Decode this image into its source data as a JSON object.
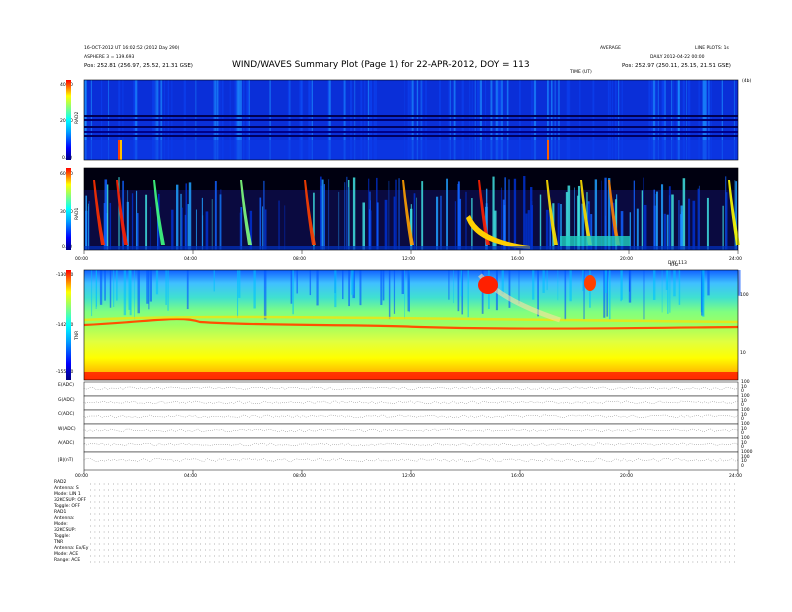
{
  "header": {
    "left_line1": "16-OCT-2012 UT 16:02:52 (2012 Day 290)",
    "left_line2": "ASPHERE 3 = 139.693",
    "left_pos": "Pos: 252.81 (256.97, 25.52, 21.31 GSE)",
    "center_title": "WIND/WAVES Summary Plot (Page 1) for 22-APR-2012, DOY = 113",
    "center_sub": "TIME (UT)",
    "right_top_a": "AVERAGE",
    "right_top_b": "LINE PLOTS: 1s",
    "right_line2": "DAILY 2012-04-22 00:00",
    "right_pos": "Pos: 252.97 (250.11, 25.15, 21.51 GSE)",
    "right_small": "(4b)",
    "time_axis_label_top": "TIME (UT)"
  },
  "chart_data": [
    {
      "type": "heatmap",
      "name": "RAD2",
      "ylabel": "RAD2",
      "ytick_labels": [
        "40.00",
        "20.00",
        "0.00"
      ],
      "ylim": [
        0,
        40
      ],
      "colorscale": [
        "#000080",
        "#0000ff",
        "#0080ff",
        "#00ffff",
        "#80ff80",
        "#ffff00",
        "#ff8000",
        "#ff0000"
      ]
    },
    {
      "type": "heatmap",
      "name": "RAD1",
      "ylabel": "RAD1",
      "ytick_labels": [
        "60.00",
        "30.00",
        "0.00"
      ],
      "ylim": [
        0,
        60
      ],
      "colorscale": [
        "#000080",
        "#0000ff",
        "#0080ff",
        "#00ffff",
        "#80ff80",
        "#ffff00",
        "#ff8000",
        "#ff0000"
      ]
    },
    {
      "type": "heatmap",
      "name": "TNR",
      "ylabel": "TNR",
      "ytick_labels": [
        "-130.00",
        "-142.50",
        "-155.00"
      ],
      "ylim": [
        -155,
        -130
      ],
      "right_axis_label": "kHz",
      "right_ticks": [
        "100",
        "10"
      ],
      "colorscale": [
        "#ff0000",
        "#ff8000",
        "#ffff00",
        "#c0ff40",
        "#80ff80",
        "#00ffff",
        "#0080ff",
        "#0000ff"
      ]
    },
    {
      "type": "line",
      "name": "line-plots",
      "series": [
        {
          "name": "E(ADC)",
          "right_ticks": [
            "100",
            "10",
            "0"
          ]
        },
        {
          "name": "G(ADC)",
          "right_ticks": [
            "100",
            "10",
            "0"
          ]
        },
        {
          "name": "C(ADC)",
          "right_ticks": [
            "100",
            "10",
            "0"
          ]
        },
        {
          "name": "W(ADC)",
          "right_ticks": [
            "100",
            "10",
            "0"
          ]
        },
        {
          "name": "A(ADC)",
          "right_ticks": [
            "100",
            "10",
            "0"
          ]
        },
        {
          "name": "|B|(nT)",
          "right_ticks": [
            "1000",
            "100",
            "10",
            "0"
          ]
        }
      ]
    }
  ],
  "time_axis": {
    "ticks_upper": [
      "00:00",
      "04:00",
      "08:00",
      "12:00",
      "16:00",
      "20:00",
      "24:00"
    ],
    "ticks_lower": [
      "00:00",
      "04:00",
      "08:00",
      "12:00",
      "16:00",
      "20:00",
      "24:00"
    ],
    "mid_label": "DAY 113"
  },
  "status_block": [
    "RAD2",
    "Antenna: S",
    "Mode: LIN 1",
    "32KCSUP: OFF",
    "Toggle: OFF",
    "RAD1",
    "Antenna:",
    "Mode:",
    "32KCSUP:",
    "Toggle:",
    "TNR",
    "Antenna: Ex/Ey",
    "Mode: ACE",
    "Range: ACE"
  ]
}
